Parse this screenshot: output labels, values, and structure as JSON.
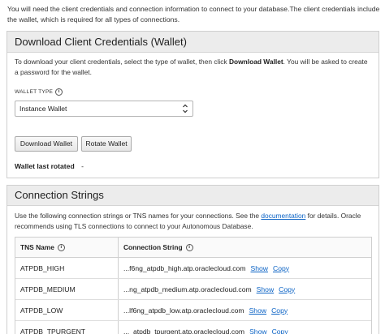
{
  "intro_text": "You will need the client credentials and connection information to connect to your database.The client credentials include the wallet, which is required for all types of connections.",
  "download_panel": {
    "title": "Download Client Credentials (Wallet)",
    "desc_prefix": "To download your client credentials, select the type of wallet, then click ",
    "desc_bold": "Download Wallet",
    "desc_suffix": ". You will be asked to create a password for the wallet.",
    "wallet_type_label": "WALLET TYPE",
    "wallet_type_value": "Instance Wallet",
    "download_button": "Download Wallet",
    "rotate_button": "Rotate Wallet",
    "last_rotated_label": "Wallet last rotated",
    "last_rotated_value": "-"
  },
  "connection_panel": {
    "title": "Connection Strings",
    "desc_prefix": "Use the following connection strings or TNS names for your connections. See the ",
    "desc_link": "documentation",
    "desc_suffix": " for details. Oracle recommends using TLS connections to connect to your Autonomous Database.",
    "col_tns": "TNS Name",
    "col_conn": "Connection String",
    "rows": [
      {
        "tns": "ATPDB_HIGH",
        "conn": "...f6ng_atpdb_high.atp.oraclecloud.com",
        "show": "Show",
        "copy": "Copy"
      },
      {
        "tns": "ATPDB_MEDIUM",
        "conn": "...ng_atpdb_medium.atp.oraclecloud.com",
        "show": "Show",
        "copy": "Copy"
      },
      {
        "tns": "ATPDB_LOW",
        "conn": "...lf6ng_atpdb_low.atp.oraclecloud.com",
        "show": "Show",
        "copy": "Copy"
      },
      {
        "tns": "ATPDB_TPURGENT",
        "conn": "..._atpdb_tpurgent.atp.oraclecloud.com",
        "show": "Show",
        "copy": "Copy"
      }
    ]
  },
  "icons": {
    "info": "info-icon",
    "chevron": "chevron-updown-icon"
  },
  "colors": {
    "link": "#0b63c5",
    "panel_header": "#ececec"
  }
}
